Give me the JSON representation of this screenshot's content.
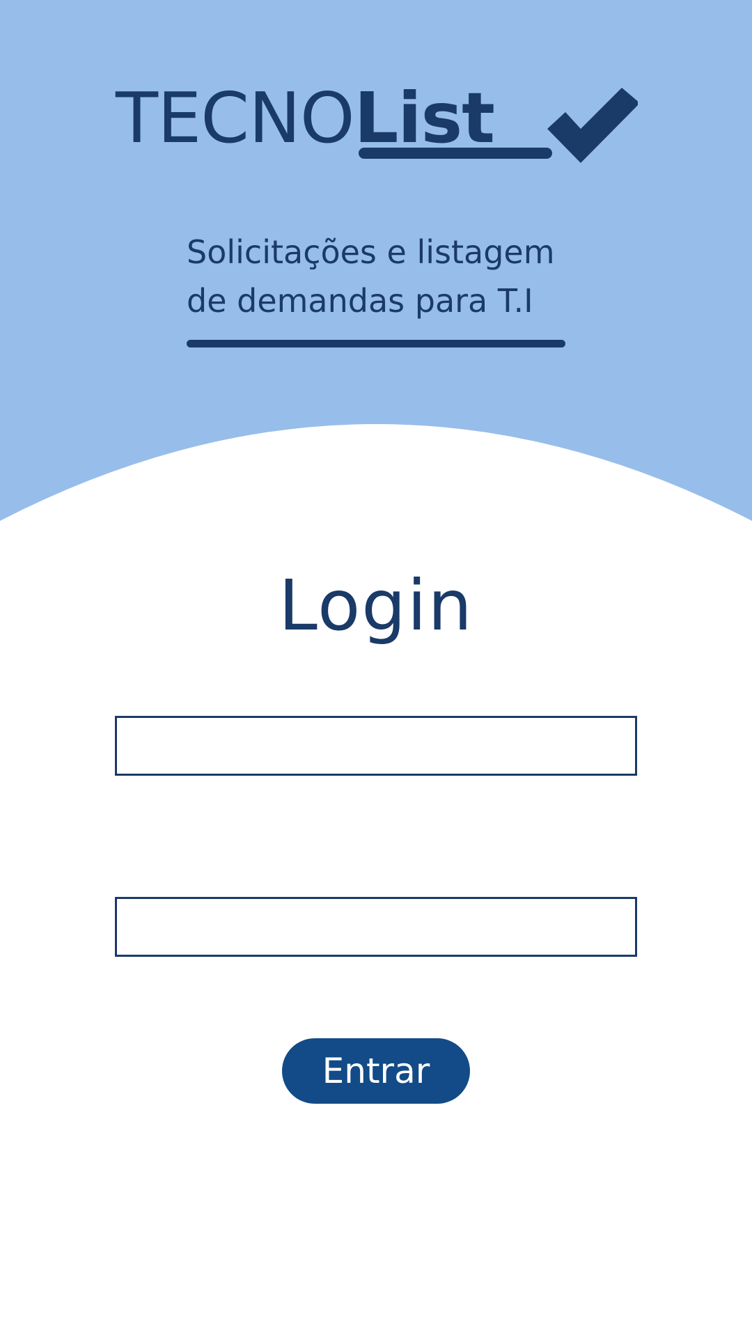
{
  "header": {
    "logo_light": "TECNO",
    "logo_bold": "List",
    "subtitle_line1": "Solicitações e listagem",
    "subtitle_line2": "de demandas para T.I",
    "logo_icon": "check-icon"
  },
  "login": {
    "title": "Login",
    "username_value": "",
    "password_value": "",
    "submit_label": "Entrar"
  },
  "colors": {
    "hero_background": "#97bdea",
    "primary_text": "#1a3a68",
    "button_background": "#124b87",
    "button_text": "#ffffff",
    "page_background": "#ffffff"
  }
}
